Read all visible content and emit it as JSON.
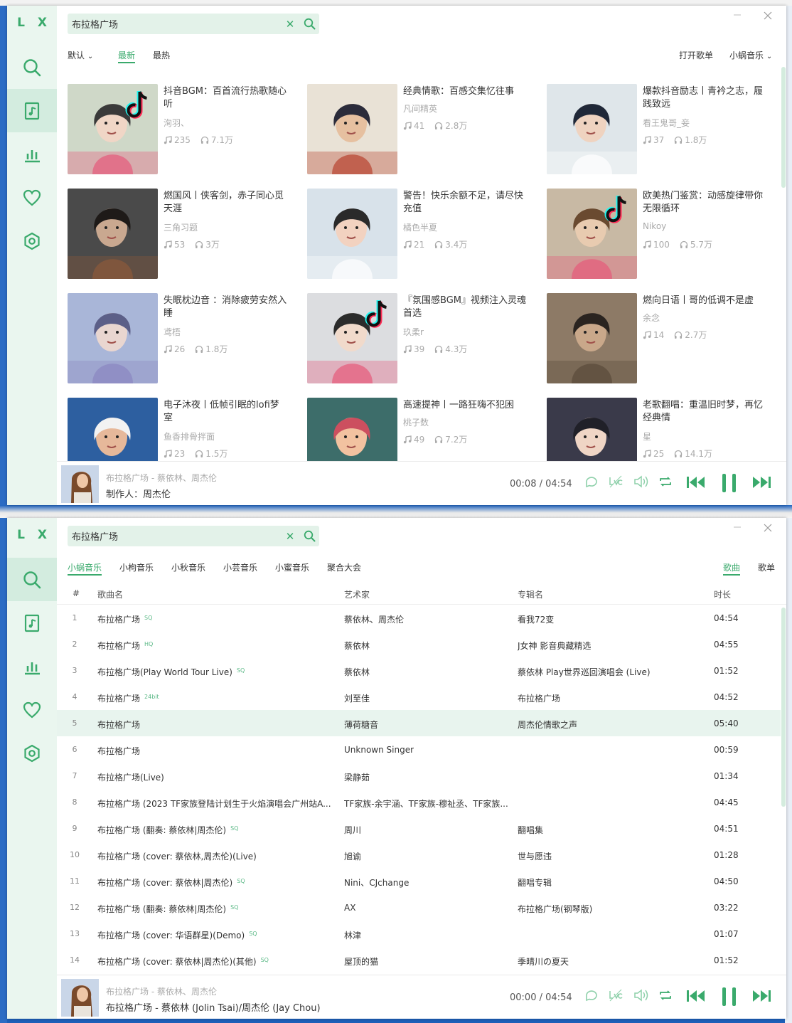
{
  "app": {
    "logo": "L X"
  },
  "colors": {
    "accent": "#3aaa6c",
    "sidebar_bg": "#eaf6ef",
    "search_bg": "#e3f2e9"
  },
  "search": {
    "value": "布拉格广场",
    "clear_icon": "close-icon",
    "search_icon": "search-icon"
  },
  "window1": {
    "filters": {
      "sort_default": "默认",
      "latest": "最新",
      "hottest": "最热",
      "open_playlist": "打开歌单",
      "source": "小蜗音乐"
    },
    "playlists": [
      {
        "title": "抖音BGM：百首流行热歌随心听",
        "author": "洵羽、",
        "songs": "235",
        "plays": "7.1万"
      },
      {
        "title": "经典情歌：百感交集忆往事",
        "author": "凡间精英",
        "songs": "41",
        "plays": "2.8万"
      },
      {
        "title": "爆款抖音励志丨青衿之志，履践致远",
        "author": "看王鬼哥_妾",
        "songs": "37",
        "plays": "1.8万"
      },
      {
        "title": "燃国风丨侠客剑，赤子同心觅天涯",
        "author": "三角习题",
        "songs": "53",
        "plays": "3万"
      },
      {
        "title": "警告！快乐余额不足，请尽快充值",
        "author": "橘色半夏",
        "songs": "21",
        "plays": "3.4万"
      },
      {
        "title": "欧美热门鉴赏：动感旋律带你无限循环",
        "author": "Nikoy",
        "songs": "100",
        "plays": "5.7万"
      },
      {
        "title": "失眠枕边音 ：消除疲劳安然入睡",
        "author": "鸢梧",
        "songs": "26",
        "plays": "1.8万"
      },
      {
        "title": "『氛围感BGM』视频注入灵魂首选",
        "author": "玖柔r",
        "songs": "39",
        "plays": "4.3万"
      },
      {
        "title": "燃向日语丨哥的低调不是虚",
        "author": "余念",
        "songs": "14",
        "plays": "2.7万"
      },
      {
        "title": "电子沐夜丨低帧引眠的lofi梦室",
        "author": "鱼香排骨拌面",
        "songs": "23",
        "plays": "1.5万"
      },
      {
        "title": "高速提神丨一路狂嗨不犯困",
        "author": "桃子数",
        "songs": "49",
        "plays": "7.2万"
      },
      {
        "title": "老歌翻唱：重温旧时梦，再忆经典情",
        "author": "星",
        "songs": "25",
        "plays": "14.1万"
      }
    ],
    "player": {
      "title": "布拉格广场 - 蔡依林、周杰伦",
      "subtitle": "制作人：周杰伦",
      "current": "00:08",
      "sep": "/",
      "total": "04:54"
    }
  },
  "window2": {
    "sources": [
      "小蜗音乐",
      "小枸音乐",
      "小秋音乐",
      "小芸音乐",
      "小蜜音乐",
      "聚合大会"
    ],
    "types": {
      "songs": "歌曲",
      "playlists": "歌单"
    },
    "columns": {
      "num": "#",
      "name": "歌曲名",
      "artist": "艺术家",
      "album": "专辑名",
      "duration": "时长"
    },
    "rows": [
      {
        "num": "1",
        "name": "布拉格广场",
        "q": "SQ",
        "artist": "蔡依林、周杰伦",
        "album": "看我72变",
        "duration": "04:54"
      },
      {
        "num": "2",
        "name": "布拉格广场",
        "q": "HQ",
        "artist": "蔡依林",
        "album": "J女神 影音典藏精选",
        "duration": "04:55"
      },
      {
        "num": "3",
        "name": "布拉格广场(Play World Tour Live)",
        "q": "SQ",
        "artist": "蔡依林",
        "album": "蔡依林 Play世界巡回演唱会 (Live)",
        "duration": "01:52"
      },
      {
        "num": "4",
        "name": "布拉格广场",
        "q": "24bit",
        "artist": "刘至佳",
        "album": "布拉格广场",
        "duration": "04:52"
      },
      {
        "num": "5",
        "name": "布拉格广场",
        "q": "",
        "artist": "薄荷糖音",
        "album": "周杰伦情歌之声",
        "duration": "05:40"
      },
      {
        "num": "6",
        "name": "布拉格广场",
        "q": "",
        "artist": "Unknown Singer",
        "album": "",
        "duration": "00:59"
      },
      {
        "num": "7",
        "name": "布拉格广场(Live)",
        "q": "",
        "artist": "梁静茹",
        "album": "",
        "duration": "01:34"
      },
      {
        "num": "8",
        "name": "布拉格广场 (2023 TF家族登陆计划生于火焰演唱会广州站A...",
        "q": "",
        "artist": "TF家族-余宇涵、TF家族-穆祉丞、TF家族...",
        "album": "",
        "duration": "04:45"
      },
      {
        "num": "9",
        "name": "布拉格广场 (翻奏: 蔡依林|周杰伦)",
        "q": "SQ",
        "artist": "周川",
        "album": "翻唱集",
        "duration": "04:51"
      },
      {
        "num": "10",
        "name": "布拉格广场 (cover: 蔡依林,周杰伦)(Live)",
        "q": "",
        "artist": "旭谕",
        "album": "世与愿违",
        "duration": "01:28"
      },
      {
        "num": "11",
        "name": "布拉格广场 (cover: 蔡依林|周杰伦)",
        "q": "SQ",
        "artist": "Nini、CJchange",
        "album": "翻唱专辑",
        "duration": "04:50"
      },
      {
        "num": "12",
        "name": "布拉格广场 (翻奏: 蔡依林|周杰伦)",
        "q": "SQ",
        "artist": "AX",
        "album": "布拉格广场(钢琴版)",
        "duration": "03:22"
      },
      {
        "num": "13",
        "name": "布拉格广场 (cover: 华语群星)(Demo)",
        "q": "SQ",
        "artist": "林津",
        "album": "",
        "duration": "01:07"
      },
      {
        "num": "14",
        "name": "布拉格广场 (cover: 蔡依林|周杰伦)(其他)",
        "q": "SQ",
        "artist": "屋顶的猫",
        "album": "季晴川の夏天",
        "duration": "01:52"
      }
    ],
    "player": {
      "title": "布拉格广场 - 蔡依林、周杰伦",
      "subtitle": "布拉格广场 - 蔡依林 (Jolin Tsai)/周杰伦 (Jay Chou)",
      "current": "00:00",
      "sep": "/",
      "total": "04:54"
    }
  }
}
